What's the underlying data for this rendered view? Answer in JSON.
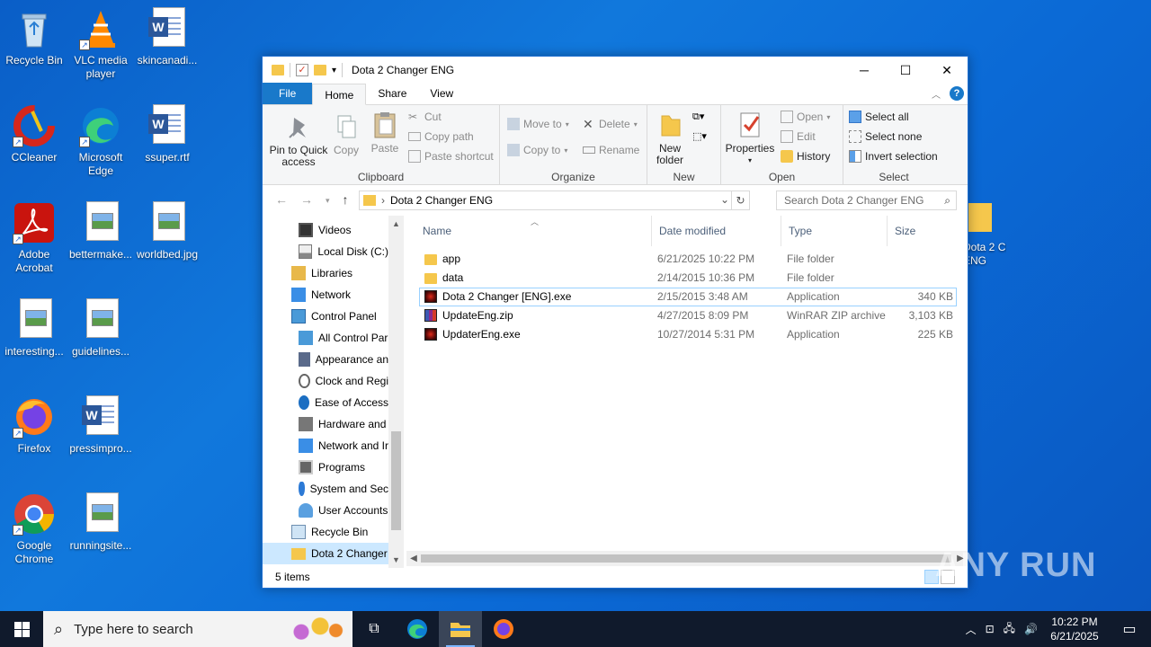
{
  "desktop": {
    "icons": [
      {
        "label": "Recycle Bin"
      },
      {
        "label": "VLC media player"
      },
      {
        "label": "skincanadi..."
      },
      {
        "label": "CCleaner"
      },
      {
        "label": "Microsoft Edge"
      },
      {
        "label": "ssuper.rtf"
      },
      {
        "label": "Adobe Acrobat"
      },
      {
        "label": "bettermake..."
      },
      {
        "label": "worldbed.jpg"
      },
      {
        "label": "interesting..."
      },
      {
        "label": "guidelines..."
      },
      {
        "label": "Firefox"
      },
      {
        "label": "pressimpro..."
      },
      {
        "label": "Google Chrome"
      },
      {
        "label": "runningsite..."
      }
    ],
    "partial_icon_label": "Dota 2 Changer ENG"
  },
  "window": {
    "title": "Dota 2 Changer ENG",
    "controls": {
      "minimize": "─",
      "maximize": "☐",
      "close": "✕"
    }
  },
  "ribbon": {
    "tabs": [
      {
        "label": "File"
      },
      {
        "label": "Home"
      },
      {
        "label": "Share"
      },
      {
        "label": "View"
      }
    ],
    "clipboard": {
      "label": "Clipboard",
      "pin": "Pin to Quick access",
      "copy": "Copy",
      "paste": "Paste",
      "cut": "Cut",
      "copy_path": "Copy path",
      "paste_shortcut": "Paste shortcut"
    },
    "organize": {
      "label": "Organize",
      "move_to": "Move to",
      "copy_to": "Copy to",
      "delete": "Delete",
      "rename": "Rename"
    },
    "new": {
      "label": "New",
      "new_folder": "New folder"
    },
    "open": {
      "label": "Open",
      "properties": "Properties",
      "open": "Open",
      "edit": "Edit",
      "history": "History"
    },
    "select": {
      "label": "Select",
      "select_all": "Select all",
      "select_none": "Select none",
      "invert_selection": "Invert selection"
    }
  },
  "address": {
    "path": "Dota 2 Changer ENG",
    "search_placeholder": "Search Dota 2 Changer ENG"
  },
  "nav_pane": {
    "items": [
      {
        "label": "Videos"
      },
      {
        "label": "Local Disk (C:)"
      },
      {
        "label": "Libraries"
      },
      {
        "label": "Network"
      },
      {
        "label": "Control Panel"
      },
      {
        "label": "All Control Par"
      },
      {
        "label": "Appearance an"
      },
      {
        "label": "Clock and Regi"
      },
      {
        "label": "Ease of Access"
      },
      {
        "label": "Hardware and"
      },
      {
        "label": "Network and Ir"
      },
      {
        "label": "Programs"
      },
      {
        "label": "System and Sec"
      },
      {
        "label": "User Accounts"
      },
      {
        "label": "Recycle Bin"
      },
      {
        "label": "Dota 2 Changer"
      }
    ]
  },
  "file_list": {
    "columns": [
      "Name",
      "Date modified",
      "Type",
      "Size"
    ],
    "rows": [
      {
        "name": "app",
        "date": "6/21/2025 10:22 PM",
        "type": "File folder",
        "size": "",
        "icon": "folder-icon"
      },
      {
        "name": "data",
        "date": "2/14/2015 10:36 PM",
        "type": "File folder",
        "size": "",
        "icon": "folder-icon"
      },
      {
        "name": "Dota 2 Changer [ENG].exe",
        "date": "2/15/2015 3:48 AM",
        "type": "Application",
        "size": "340 KB",
        "icon": "app-icon"
      },
      {
        "name": "UpdateEng.zip",
        "date": "4/27/2015 8:09 PM",
        "type": "WinRAR ZIP archive",
        "size": "3,103 KB",
        "icon": "winrar-icon"
      },
      {
        "name": "UpdaterEng.exe",
        "date": "10/27/2014 5:31 PM",
        "type": "Application",
        "size": "225 KB",
        "icon": "app-icon"
      }
    ]
  },
  "status": {
    "item_count": "5 items"
  },
  "taskbar": {
    "search_placeholder": "Type here to search",
    "time": "10:22 PM",
    "date": "6/21/2025"
  },
  "watermark": "ANY RUN",
  "colors": {
    "accent": "#1979ca",
    "folder": "#f5c74c",
    "desktop": "#0b6ad6",
    "taskbar": "#101a2c"
  }
}
